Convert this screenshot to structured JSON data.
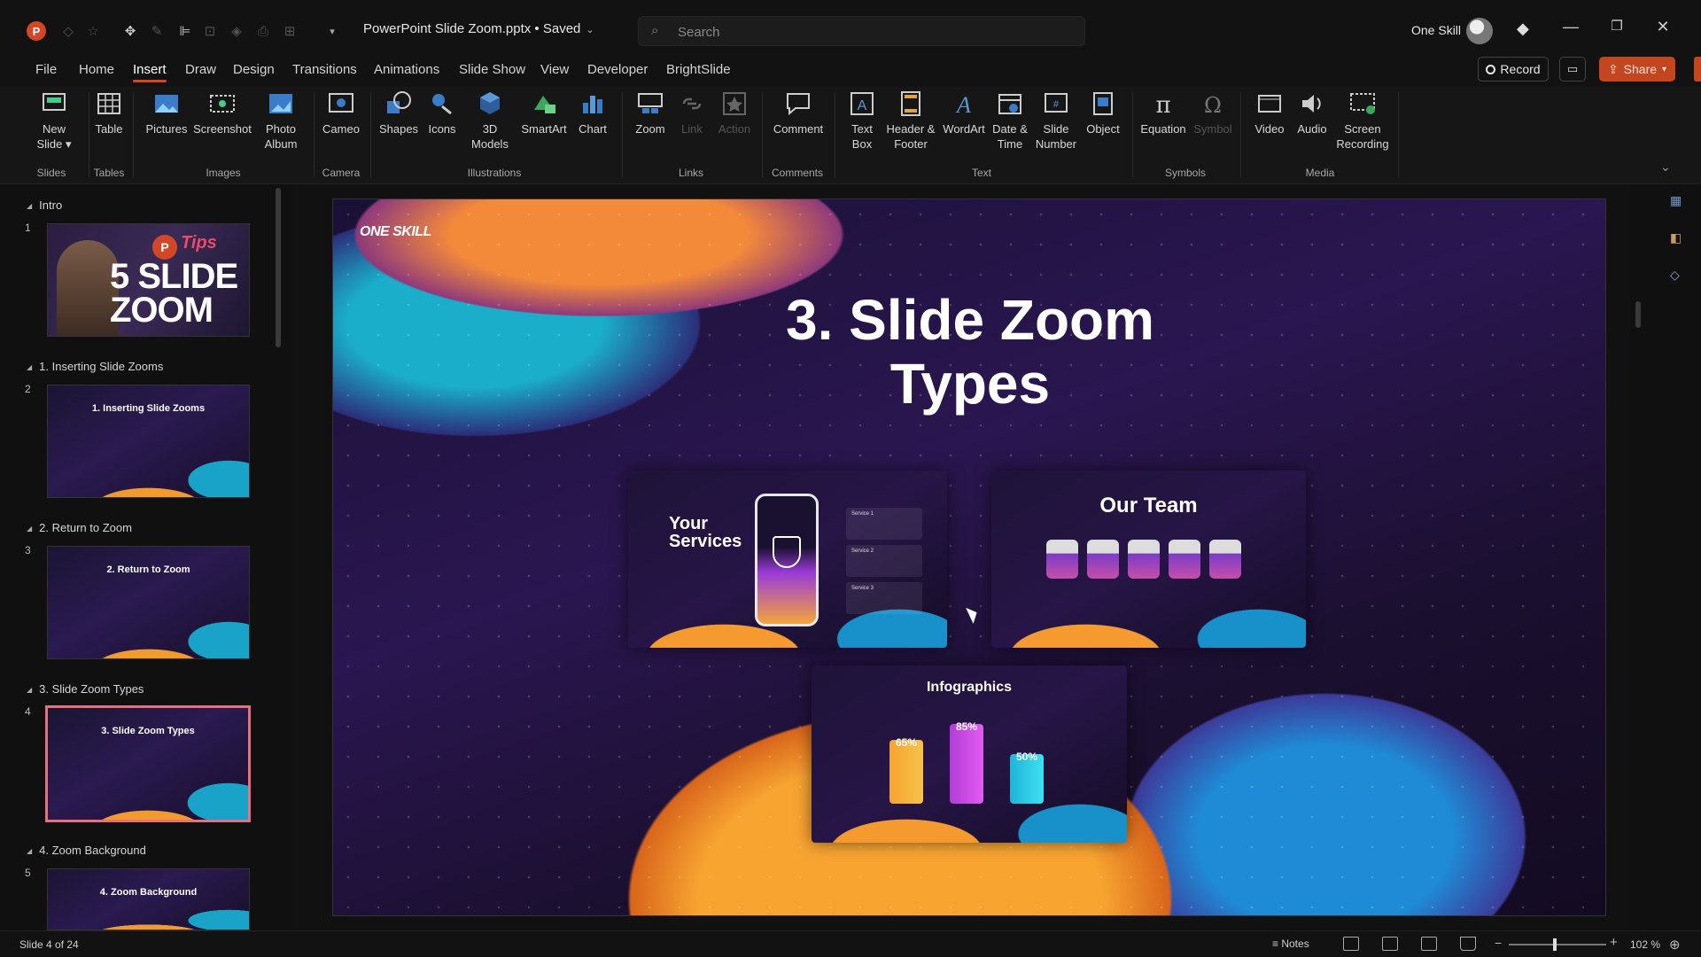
{
  "titlebar": {
    "doc_title": "PowerPoint Slide Zoom.pptx • Saved",
    "search_placeholder": "Search",
    "user_name": "One Skill"
  },
  "menu": [
    "File",
    "Home",
    "Insert",
    "Draw",
    "Design",
    "Transitions",
    "Animations",
    "Slide Show",
    "View",
    "Developer",
    "BrightSlide"
  ],
  "active_tab": "Insert",
  "actions": {
    "record": "Record",
    "share": "Share"
  },
  "ribbon": {
    "buttons": [
      {
        "id": "new-slide",
        "label": "New Slide",
        "icon": "new-slide-icon"
      },
      {
        "id": "table",
        "label": "Table",
        "icon": "table-icon"
      },
      {
        "id": "pictures",
        "label": "Pictures",
        "icon": "pictures-icon"
      },
      {
        "id": "screenshot",
        "label": "Screenshot",
        "icon": "screenshot-icon"
      },
      {
        "id": "photo-album",
        "label": "Photo Album",
        "icon": "photo-album-icon"
      },
      {
        "id": "cameo",
        "label": "Cameo",
        "icon": "cameo-icon"
      },
      {
        "id": "shapes",
        "label": "Shapes",
        "icon": "shapes-icon"
      },
      {
        "id": "icons",
        "label": "Icons",
        "icon": "icons-icon"
      },
      {
        "id": "3d-models",
        "label": "3D Models",
        "icon": "3d-models-icon"
      },
      {
        "id": "smartart",
        "label": "SmartArt",
        "icon": "smartart-icon"
      },
      {
        "id": "chart",
        "label": "Chart",
        "icon": "chart-icon"
      },
      {
        "id": "zoom",
        "label": "Zoom",
        "icon": "zoom-icon"
      },
      {
        "id": "link",
        "label": "Link",
        "icon": "link-icon"
      },
      {
        "id": "action",
        "label": "Action",
        "icon": "action-icon"
      },
      {
        "id": "comment",
        "label": "Comment",
        "icon": "comment-icon"
      },
      {
        "id": "text-box",
        "label": "Text Box",
        "icon": "text-box-icon"
      },
      {
        "id": "header-footer",
        "label": "Header & Footer",
        "icon": "header-footer-icon"
      },
      {
        "id": "wordart",
        "label": "WordArt",
        "icon": "wordart-icon"
      },
      {
        "id": "date-time",
        "label": "Date & Time",
        "icon": "date-time-icon"
      },
      {
        "id": "slide-number",
        "label": "Slide Number",
        "icon": "slide-number-icon"
      },
      {
        "id": "object",
        "label": "Object",
        "icon": "object-icon"
      },
      {
        "id": "equation",
        "label": "Equation",
        "icon": "equation-icon"
      },
      {
        "id": "symbol",
        "label": "Symbol",
        "icon": "symbol-icon"
      },
      {
        "id": "video",
        "label": "Video",
        "icon": "video-icon"
      },
      {
        "id": "audio",
        "label": "Audio",
        "icon": "audio-icon"
      },
      {
        "id": "screen-recording",
        "label": "Screen Recording",
        "icon": "screen-recording-icon"
      }
    ],
    "groups": [
      "Slides",
      "Tables",
      "Images",
      "Camera",
      "Illustrations",
      "Links",
      "Comments",
      "Text",
      "Symbols",
      "Media"
    ]
  },
  "slides_panel": {
    "sections": [
      "Intro",
      "1. Inserting Slide Zooms",
      "2. Return to Zoom",
      "3. Slide Zoom Types",
      "4. Zoom Background"
    ],
    "thumbs": [
      {
        "num": "1",
        "title": "5 SLIDE ZOOM",
        "badge": "Tips"
      },
      {
        "num": "2",
        "title": "1. Inserting Slide Zooms"
      },
      {
        "num": "3",
        "title": "2. Return to Zoom"
      },
      {
        "num": "4",
        "title": "3. Slide Zoom Types"
      },
      {
        "num": "5",
        "title": "4. Zoom Background"
      }
    ],
    "selected": "4"
  },
  "slide": {
    "logo": "ONE SKILL",
    "title_line1": "3. Slide Zoom",
    "title_line2": "Types",
    "zoom_cards": {
      "services": {
        "title": "Your Services",
        "items": [
          "Service 1",
          "Service 2",
          "Service 3"
        ]
      },
      "team": {
        "title": "Our Team"
      },
      "infographics": {
        "title": "Infographics",
        "values": [
          "65%",
          "85%",
          "50%"
        ]
      }
    }
  },
  "status": {
    "slide_count": "Slide 4 of 24",
    "notes": "Notes",
    "zoom": "102 %"
  },
  "colors": {
    "accent": "#d24726",
    "share": "#c4461e",
    "selected_thumb": "#e8707c"
  }
}
